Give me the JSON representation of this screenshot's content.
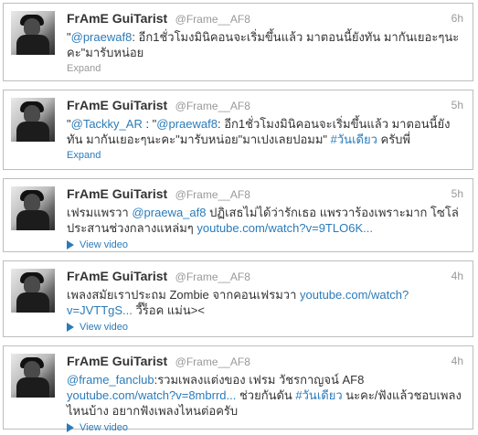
{
  "tweets": [
    {
      "name": "FrAmE GuiTarist",
      "handle": "@Frame__AF8",
      "time": "6h",
      "parts": [
        {
          "t": "\""
        },
        {
          "t": "@praewaf8",
          "link": true
        },
        {
          "t": ": อีก1ชั่วโมงมินิคอนจะเริ่มขึ้นแล้ว มาตอนนี้ยังทัน มากันเยอะๆนะคะ\"มารับหน่อย"
        }
      ],
      "footer": "Expand",
      "footer_type": "expand-grey"
    },
    {
      "name": "FrAmE GuiTarist",
      "handle": "@Frame__AF8",
      "time": "5h",
      "parts": [
        {
          "t": "\""
        },
        {
          "t": "@Tackky_AR",
          "link": true
        },
        {
          "t": " : \""
        },
        {
          "t": "@praewaf8",
          "link": true
        },
        {
          "t": ": อีก1ชั่วโมงมินิคอนจะเริ่มขึ้นแล้ว มาตอนนี้ยังทัน มากันเยอะๆนะคะ\"มารับหน่อย\"มาเปงเลยปอมม\" "
        },
        {
          "t": "#วันเดียว",
          "link": true
        },
        {
          "t": " ครับพี่"
        }
      ],
      "footer": "Expand",
      "footer_type": "expand-blue"
    },
    {
      "name": "FrAmE GuiTarist",
      "handle": "@Frame__AF8",
      "time": "5h",
      "parts": [
        {
          "t": "เฟรมแพรวา "
        },
        {
          "t": "@praewa_af8",
          "link": true
        },
        {
          "t": " ปฏิเสธไม่ได้ว่ารักเธอ แพรวาร้องเพราะมาก โซโล่ประสานช่วงกลางแหล่มๆ "
        },
        {
          "t": "youtube.com/watch?v=9TLO6K...",
          "link": true
        }
      ],
      "footer": "View video",
      "footer_type": "video"
    },
    {
      "name": "FrAmE GuiTarist",
      "handle": "@Frame__AF8",
      "time": "4h",
      "parts": [
        {
          "t": "เพลงสมัยเราประถม Zombie จากคอนเฟรมวา "
        },
        {
          "t": "youtube.com/watch?v=JVTTgS...",
          "link": true
        },
        {
          "t": " วี๊ร็อค แม่น><"
        }
      ],
      "footer": "View video",
      "footer_type": "video"
    },
    {
      "name": "FrAmE GuiTarist",
      "handle": "@Frame__AF8",
      "time": "4h",
      "parts": [
        {
          "t": "@frame_fanclub",
          "link": true
        },
        {
          "t": ":รวมเพลงแต่งของ เฟรม วัชรกาญจน์ AF8 "
        },
        {
          "t": "youtube.com/watch?v=8mbrrd...",
          "link": true
        },
        {
          "t": " ช่วยกันดัน "
        },
        {
          "t": "#วันเดียว",
          "link": true
        },
        {
          "t": " นะคะ/ฟังแล้วชอบเพลงไหนบ้าง อยากฟังเพลงไหนต่อครับ"
        }
      ],
      "footer": "View video",
      "footer_type": "video"
    }
  ],
  "colors": {
    "link": "#2b7bb9",
    "name": "#333333",
    "meta": "#999999",
    "border": "#bdbdbd"
  }
}
